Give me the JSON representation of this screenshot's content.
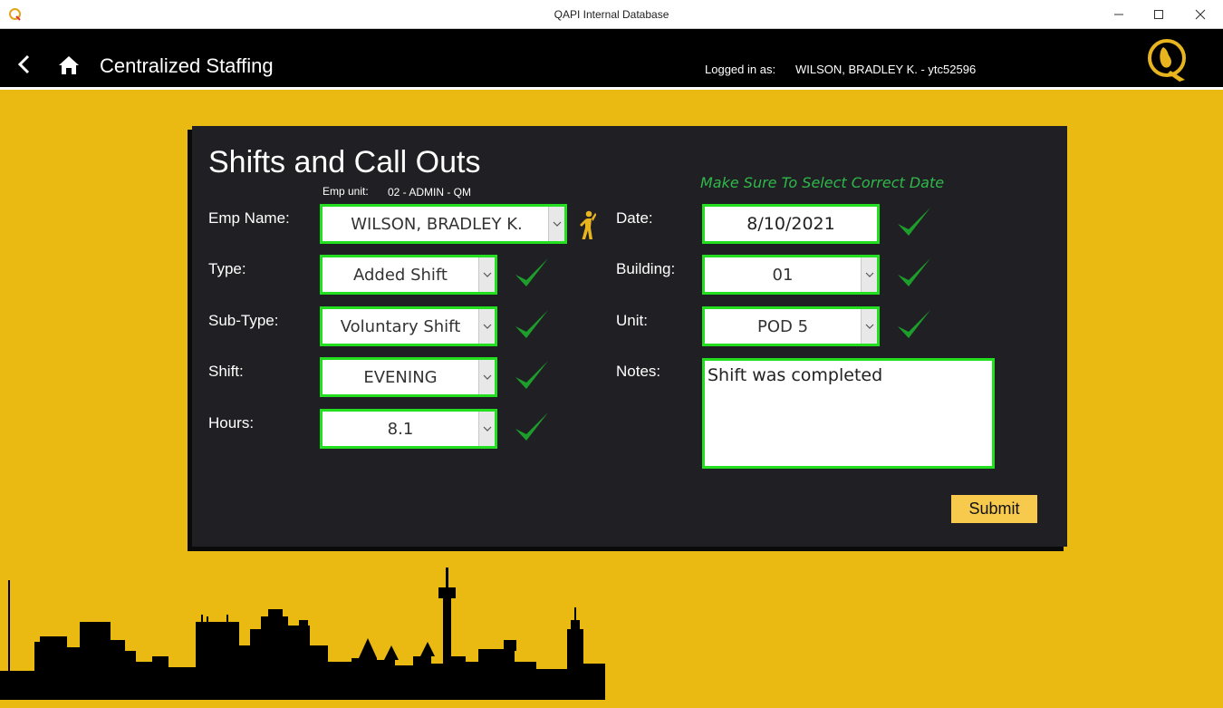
{
  "window": {
    "title": "QAPI Internal Database",
    "icons": [
      "app-icon",
      "minimize-icon",
      "maximize-icon",
      "close-icon"
    ]
  },
  "header": {
    "page_title": "Centralized Staffing",
    "logged_in_label": "Logged in as:",
    "logged_in_user": "WILSON, BRADLEY K. - ytc52596",
    "icons": [
      "back-icon",
      "home-icon",
      "q-logo"
    ]
  },
  "form": {
    "title": "Shifts and Call Outs",
    "emp_unit_label": "Emp unit:",
    "emp_unit_value": "02 - ADMIN - QM",
    "date_note": "Make Sure To Select Correct Date",
    "emp_name": {
      "label": "Emp Name:",
      "value": "WILSON, BRADLEY K."
    },
    "type": {
      "label": "Type:",
      "value": "Added Shift"
    },
    "sub_type": {
      "label": "Sub-Type:",
      "value": "Voluntary Shift"
    },
    "shift": {
      "label": "Shift:",
      "value": "EVENING"
    },
    "hours": {
      "label": "Hours:",
      "value": "8.1"
    },
    "date": {
      "label": "Date:",
      "value": "8/10/2021"
    },
    "building": {
      "label": "Building:",
      "value": "01"
    },
    "unit": {
      "label": "Unit:",
      "value": "POD 5"
    },
    "notes": {
      "label": "Notes:",
      "value": "Shift was completed"
    },
    "submit_label": "Submit"
  },
  "colors": {
    "background": "#eaba12",
    "card": "#202024",
    "valid_border": "#22e01f",
    "check": "#1d9e2b",
    "note_text": "#2fb84a",
    "submit": "#f7c94d"
  }
}
